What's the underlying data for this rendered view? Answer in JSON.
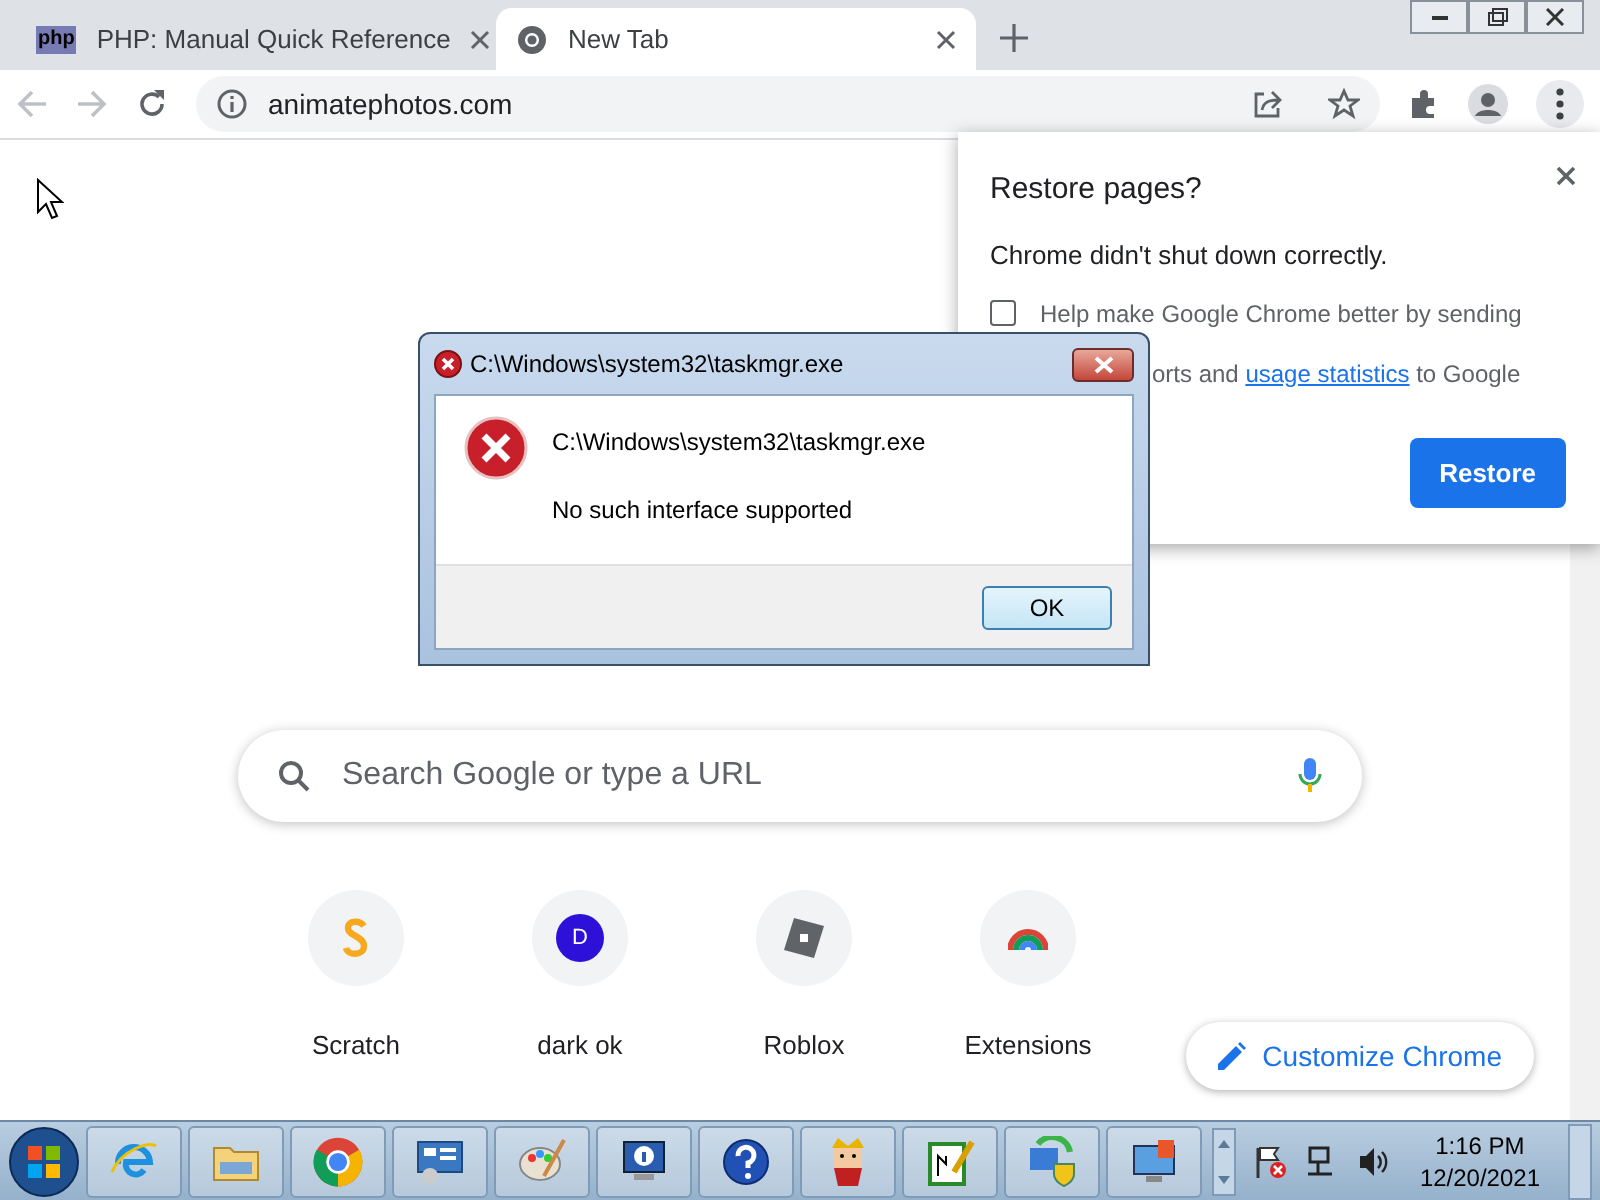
{
  "browser": {
    "tabs": [
      {
        "title": "PHP: Manual Quick Reference",
        "selected": false,
        "kind": "php",
        "icon_label": "php"
      },
      {
        "title": "New Tab",
        "selected": true,
        "kind": "chrome"
      }
    ],
    "address": "animatephotos.com"
  },
  "restore_popup": {
    "title": "Restore pages?",
    "message": "Chrome didn't shut down correctly.",
    "checkbox": {
      "checked": false,
      "line_1": "Help make Google Chrome better by sending",
      "line_2_start": "orts and",
      "link": "usage statistics",
      "line_2_end": "to Google"
    },
    "button": "Restore"
  },
  "error_dialog": {
    "title": "C:\\Windows\\system32\\taskmgr.exe",
    "path": "C:\\Windows\\system32\\taskmgr.exe",
    "message": "No such interface supported",
    "button": "OK"
  },
  "new_tab": {
    "search_placeholder": "Search Google or type a URL",
    "shortcuts": [
      {
        "label": "Scratch",
        "kind": "scratch"
      },
      {
        "label": "dark ok",
        "kind": "letter",
        "letter": "D"
      },
      {
        "label": "Roblox",
        "kind": "roblox"
      },
      {
        "label": "Extensions",
        "kind": "extensions"
      }
    ],
    "customize_button": "Customize Chrome"
  },
  "taskbar": {
    "apps": [
      {
        "kind": "ie"
      },
      {
        "kind": "explorer"
      },
      {
        "kind": "chrome"
      },
      {
        "kind": "control-panel"
      },
      {
        "kind": "paint"
      },
      {
        "kind": "info"
      },
      {
        "kind": "help"
      },
      {
        "kind": "solitaire"
      },
      {
        "kind": "notepad"
      },
      {
        "kind": "network"
      },
      {
        "kind": "remote"
      }
    ],
    "time": "1:16 PM",
    "date": "12/20/2021"
  }
}
